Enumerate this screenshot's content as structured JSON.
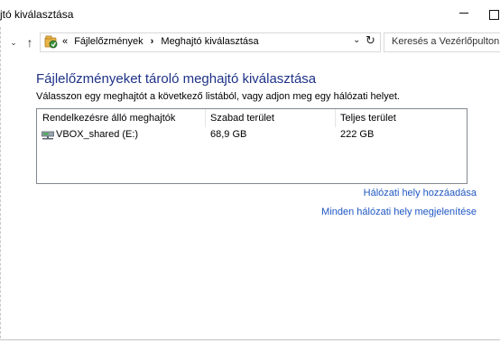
{
  "window": {
    "title": "jtó kiválasztása",
    "minimize_glyph": "—",
    "maximize_glyph": ""
  },
  "nav": {
    "recent_glyph": "⌄",
    "up_glyph": "↑",
    "breadcrumb_prefix": "«",
    "breadcrumbs": [
      "Fájlelőzmények",
      "Meghajtó kiválasztása"
    ],
    "breadcrumb_separator": "›",
    "dropdown_glyph": "⌄",
    "refresh_glyph": "↻",
    "search_placeholder": "Keresés a Vezérlőpulton"
  },
  "content": {
    "heading": "Fájlelőzményeket tároló meghajtó kiválasztása",
    "instruction": "Válasszon egy meghajtót a következő listából, vagy adjon meg egy hálózati helyet.",
    "columns": [
      "Rendelkezésre álló meghajtók",
      "Szabad terület",
      "Teljes terület"
    ],
    "drives": [
      {
        "name": "VBOX_shared (E:)",
        "free": "68,9 GB",
        "total": "222 GB",
        "icon": "network-drive-icon"
      }
    ],
    "links": {
      "add_network": "Hálózati hely hozzáadása",
      "show_all_network": "Minden hálózati hely megjelenítése"
    }
  },
  "colors": {
    "heading": "#1e3287",
    "link": "#1f57c3",
    "list_border": "#828790"
  }
}
